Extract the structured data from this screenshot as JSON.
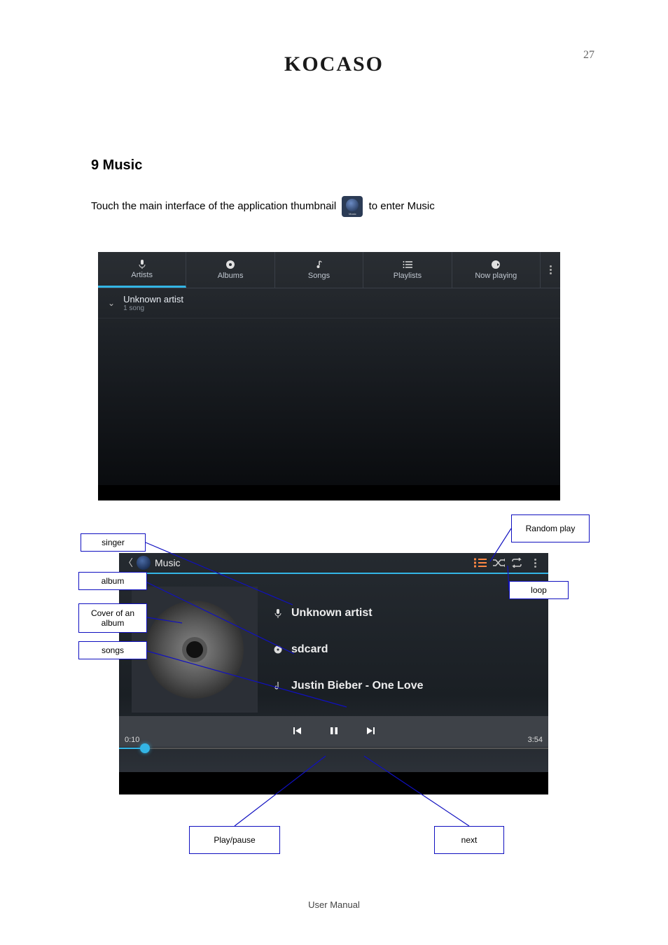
{
  "brand": "KOCASO",
  "page_number_top": "27",
  "section_title": "9 Music",
  "intro_a": "Touch the main interface of the application thumbnail ",
  "intro_b": " to enter Music",
  "tabs": [
    "Artists",
    "Albums",
    "Songs",
    "Playlists",
    "Now playing"
  ],
  "artist": {
    "name": "Unknown artist",
    "song_count": "1 song"
  },
  "playback": {
    "app_title": "Music",
    "artist": "Unknown artist",
    "album": "sdcard",
    "track": "Justin Bieber - One Love",
    "elapsed": "0:10",
    "duration": "3:54"
  },
  "callouts": {
    "singer": "singer",
    "album": "album",
    "cover": "Cover of an album",
    "songs": "songs",
    "random_play": "Random play",
    "loop": "loop",
    "play_pause": "Play/pause",
    "next": "next"
  },
  "footer": "User Manual"
}
